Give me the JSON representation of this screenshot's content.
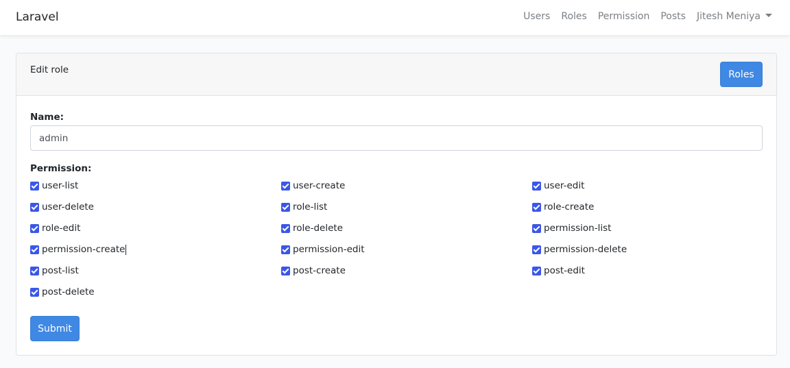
{
  "navbar": {
    "brand": "Laravel",
    "links": [
      "Users",
      "Roles",
      "Permission",
      "Posts"
    ],
    "user": "Jitesh Meniya"
  },
  "card": {
    "title": "Edit role",
    "roles_button": "Roles",
    "name_label": "Name:",
    "name_value": "admin",
    "permission_label": "Permission:",
    "permissions": [
      {
        "label": "user-list",
        "checked": true
      },
      {
        "label": "user-create",
        "checked": true
      },
      {
        "label": "user-edit",
        "checked": true
      },
      {
        "label": "user-delete",
        "checked": true
      },
      {
        "label": "role-list",
        "checked": true
      },
      {
        "label": "role-create",
        "checked": true
      },
      {
        "label": "role-edit",
        "checked": true
      },
      {
        "label": "role-delete",
        "checked": true
      },
      {
        "label": "permission-list",
        "checked": true
      },
      {
        "label": "permission-create",
        "checked": true
      },
      {
        "label": "permission-edit",
        "checked": true
      },
      {
        "label": "permission-delete",
        "checked": true
      },
      {
        "label": "post-list",
        "checked": true
      },
      {
        "label": "post-create",
        "checked": true
      },
      {
        "label": "post-edit",
        "checked": true
      },
      {
        "label": "post-delete",
        "checked": true
      }
    ],
    "submit_button": "Submit"
  },
  "colors": {
    "primary": "#3f88e3",
    "checkbox": "#3a57e8",
    "nav_text": "#7a7f85"
  }
}
